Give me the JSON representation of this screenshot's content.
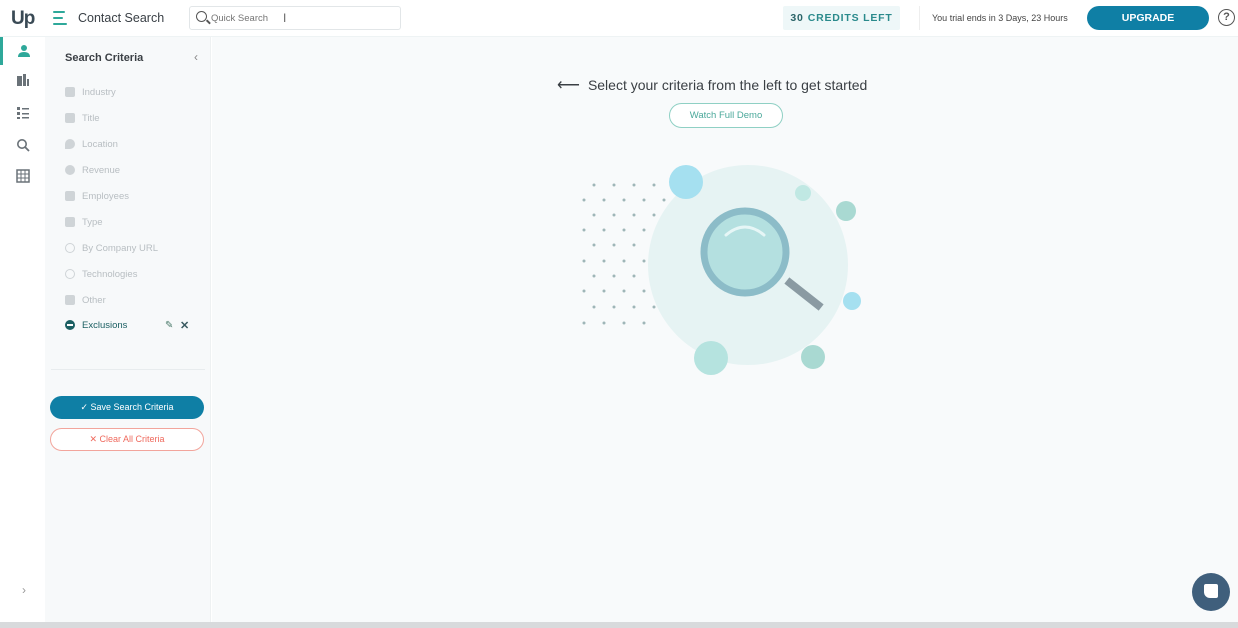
{
  "header": {
    "logo": "Up",
    "page_title": "Contact Search",
    "search_placeholder": "Quick Search",
    "credits_count": "30",
    "credits_label": "CREDITS LEFT",
    "trial_text": "You trial ends in 3 Days, 23 Hours",
    "upgrade_label": "UPGRADE",
    "help_label": "?"
  },
  "rail": {
    "items": [
      {
        "icon": "person-icon",
        "active": true
      },
      {
        "icon": "building-icon",
        "active": false
      },
      {
        "icon": "list-icon",
        "active": false
      },
      {
        "icon": "search-icon",
        "active": false
      },
      {
        "icon": "table-icon",
        "active": false
      }
    ],
    "expand_label": "›"
  },
  "panel": {
    "title": "Search Criteria",
    "collapse_label": "‹",
    "criteria": [
      {
        "label": "Industry",
        "icon": "building-icon"
      },
      {
        "label": "Title",
        "icon": "briefcase-icon"
      },
      {
        "label": "Location",
        "icon": "location-pin-icon"
      },
      {
        "label": "Revenue",
        "icon": "dollar-icon"
      },
      {
        "label": "Employees",
        "icon": "people-icon"
      },
      {
        "label": "Type",
        "icon": "factory-icon"
      },
      {
        "label": "By Company URL",
        "icon": "link-icon"
      },
      {
        "label": "Technologies",
        "icon": "gear-icon"
      },
      {
        "label": "Other",
        "icon": "grid-icon"
      },
      {
        "label": "Exclusions",
        "icon": "minus-circle-icon"
      }
    ],
    "edit_glyph": "✎",
    "remove_glyph": "✕",
    "save_label": "✓  Save Search Criteria",
    "clear_label": "✕  Clear All Criteria"
  },
  "main": {
    "arrow": "⟵",
    "prompt": "Select your criteria from the left to get started",
    "demo_label": "Watch Full Demo"
  },
  "colors": {
    "accent": "#2ea89a",
    "primary_button": "#0f7fa5",
    "danger": "#ef6a5e"
  }
}
